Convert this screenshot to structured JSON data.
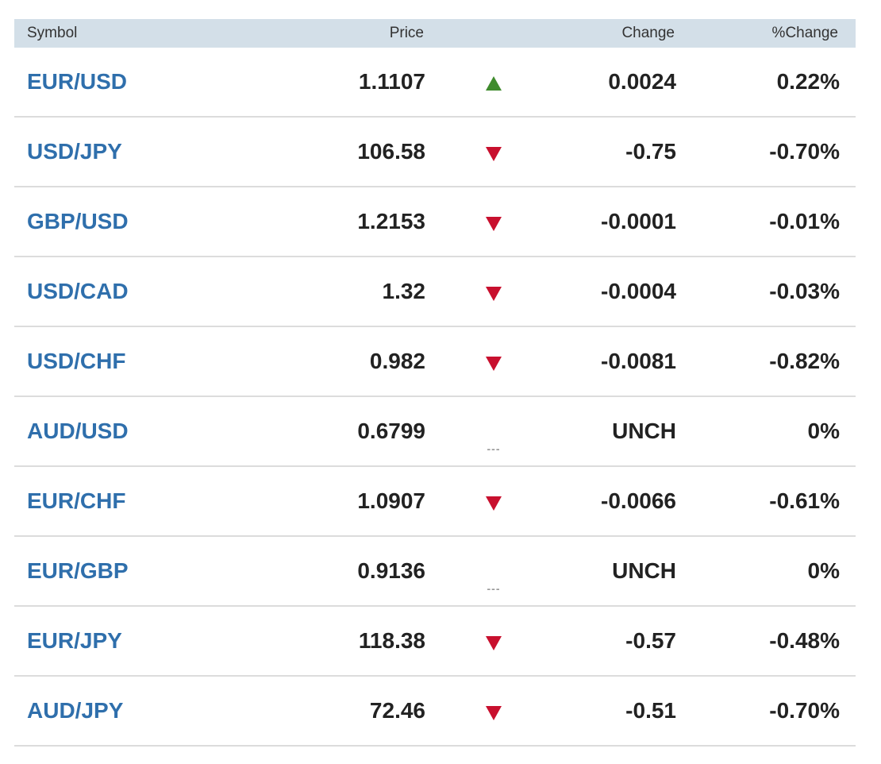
{
  "header": {
    "symbol": "Symbol",
    "price": "Price",
    "change": "Change",
    "pct_change": "%Change"
  },
  "colors": {
    "header_bg": "#d3dfe8",
    "symbol_link": "#2f6fac",
    "up": "#3f8b2d",
    "down": "#c8102e",
    "flat": "#9a9a9a"
  },
  "rows": [
    {
      "symbol": "EUR/USD",
      "price": "1.1107",
      "direction": "up",
      "change": "0.0024",
      "pct_change": "0.22%"
    },
    {
      "symbol": "USD/JPY",
      "price": "106.58",
      "direction": "down",
      "change": "-0.75",
      "pct_change": "-0.70%"
    },
    {
      "symbol": "GBP/USD",
      "price": "1.2153",
      "direction": "down",
      "change": "-0.0001",
      "pct_change": "-0.01%"
    },
    {
      "symbol": "USD/CAD",
      "price": "1.32",
      "direction": "down",
      "change": "-0.0004",
      "pct_change": "-0.03%"
    },
    {
      "symbol": "USD/CHF",
      "price": "0.982",
      "direction": "down",
      "change": "-0.0081",
      "pct_change": "-0.82%"
    },
    {
      "symbol": "AUD/USD",
      "price": "0.6799",
      "direction": "flat",
      "change": "UNCH",
      "pct_change": "0%"
    },
    {
      "symbol": "EUR/CHF",
      "price": "1.0907",
      "direction": "down",
      "change": "-0.0066",
      "pct_change": "-0.61%"
    },
    {
      "symbol": "EUR/GBP",
      "price": "0.9136",
      "direction": "flat",
      "change": "UNCH",
      "pct_change": "0%"
    },
    {
      "symbol": "EUR/JPY",
      "price": "118.38",
      "direction": "down",
      "change": "-0.57",
      "pct_change": "-0.48%"
    },
    {
      "symbol": "AUD/JPY",
      "price": "72.46",
      "direction": "down",
      "change": "-0.51",
      "pct_change": "-0.70%"
    }
  ],
  "flat_glyph": "---"
}
